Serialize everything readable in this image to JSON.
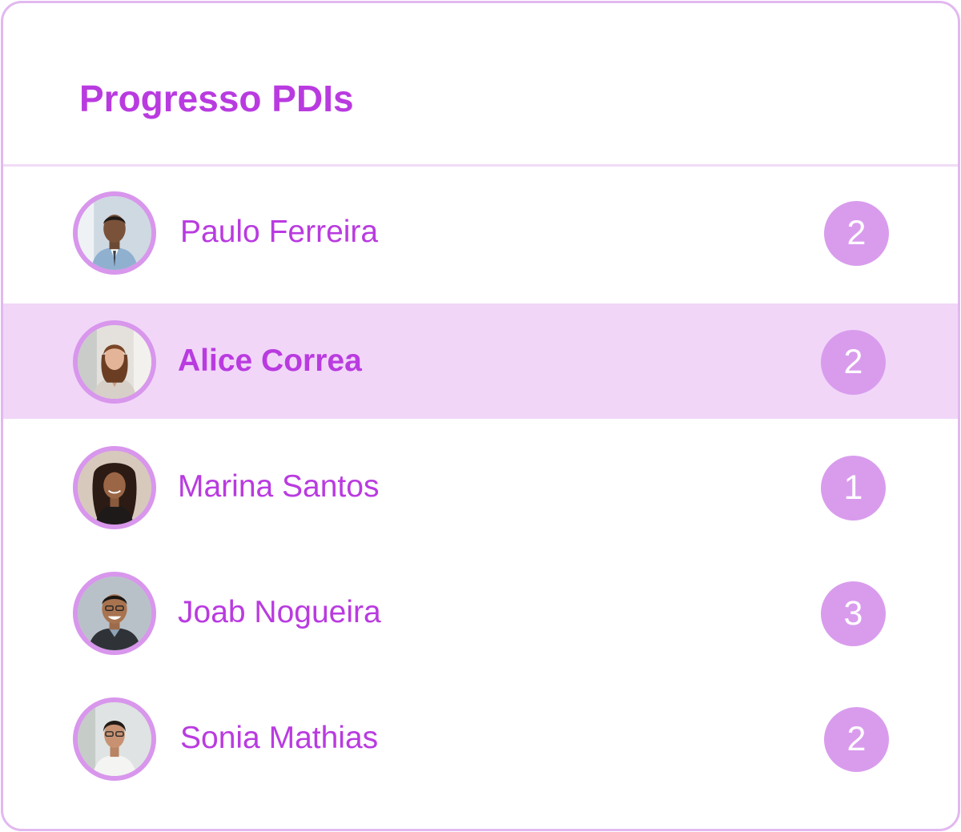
{
  "card": {
    "title": "Progresso PDIs"
  },
  "people": [
    {
      "name": "Paulo Ferreira",
      "count": "2",
      "selected": false
    },
    {
      "name": "Alice Correa",
      "count": "2",
      "selected": true
    },
    {
      "name": "Marina Santos",
      "count": "1",
      "selected": false
    },
    {
      "name": "Joab Nogueira",
      "count": "3",
      "selected": false
    },
    {
      "name": "Sonia Mathias",
      "count": "2",
      "selected": false
    }
  ],
  "colors": {
    "accent": "#b93be0",
    "badge": "#d99ced",
    "selected_row": "#f1d6f8",
    "border": "#e2b8ef"
  }
}
